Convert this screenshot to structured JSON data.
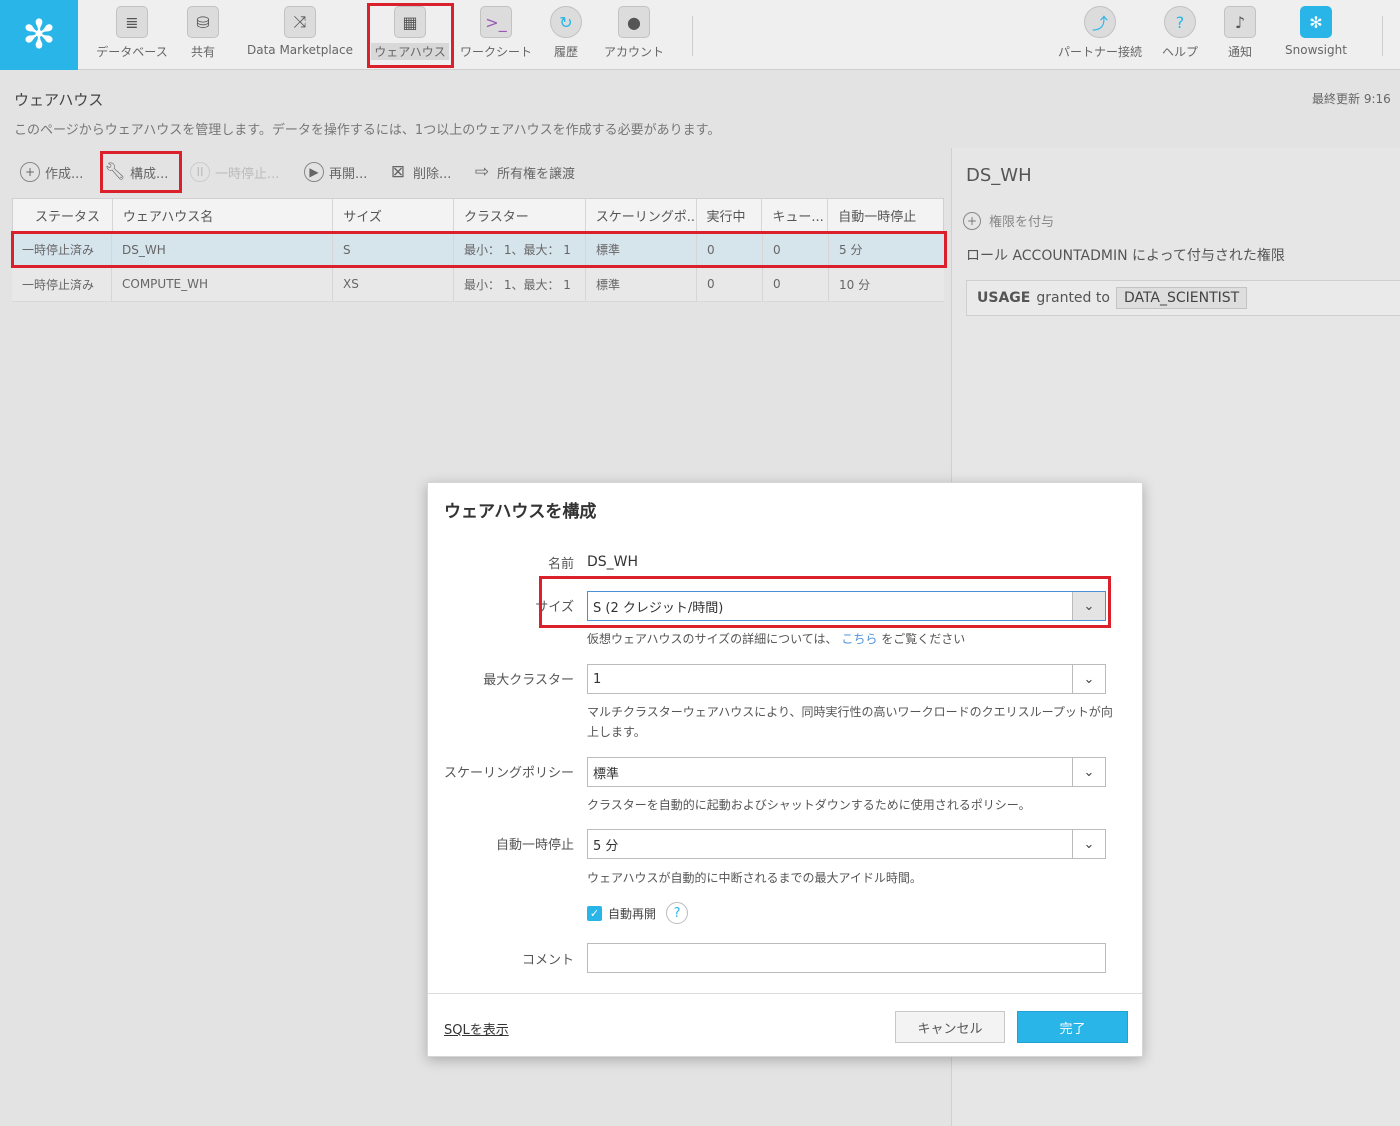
{
  "nav": {
    "items": [
      {
        "label": "データベース",
        "icon": "database-icon"
      },
      {
        "label": "共有",
        "icon": "share-icon"
      },
      {
        "label": "Data Marketplace",
        "icon": "marketplace-icon"
      },
      {
        "label": "ウェアハウス",
        "icon": "warehouse-icon"
      },
      {
        "label": "ワークシート",
        "icon": "worksheet-icon"
      },
      {
        "label": "履歴",
        "icon": "history-icon"
      },
      {
        "label": "アカウント",
        "icon": "account-icon"
      },
      {
        "label": "パートナー接続",
        "icon": "partner-connect-icon"
      },
      {
        "label": "ヘルプ",
        "icon": "help-icon"
      },
      {
        "label": "通知",
        "icon": "bell-icon"
      },
      {
        "label": "Snowsight",
        "icon": "snowsight-icon"
      }
    ]
  },
  "page": {
    "title": "ウェアハウス",
    "description": "このページからウェアハウスを管理します。データを操作するには、1つ以上のウェアハウスを作成する必要があります。",
    "last_update": "最終更新 9:16"
  },
  "toolbar": {
    "create": "作成...",
    "configure": "構成...",
    "suspend": "一時停止...",
    "resume": "再開...",
    "delete": "削除...",
    "transfer": "所有権を譲渡"
  },
  "table": {
    "headers": [
      "ステータス",
      "ウェアハウス名",
      "サイズ",
      "クラスター",
      "スケーリングポ...",
      "実行中",
      "キュー...",
      "自動一時停止"
    ],
    "rows": [
      [
        "一時停止済み",
        "DS_WH",
        "S",
        "最小： 1、最大： 1",
        "標準",
        "0",
        "0",
        "5 分"
      ],
      [
        "一時停止済み",
        "COMPUTE_WH",
        "XS",
        "最小： 1、最大： 1",
        "標準",
        "0",
        "0",
        "10 分"
      ]
    ]
  },
  "right_panel": {
    "title": "DS_WH",
    "grant_label": "権限を付与",
    "role_text": "ロール ACCOUNTADMIN によって付与された権限",
    "privilege": "USAGE",
    "granted_to": "granted to",
    "grantee": "DATA_SCIENTIST"
  },
  "dialog": {
    "title": "ウェアハウスを構成",
    "name_label": "名前",
    "name_value": "DS_WH",
    "size_label": "サイズ",
    "size_value": "S  (2 クレジット/時間)",
    "size_help_prefix": "仮想ウェアハウスのサイズの詳細については、",
    "size_help_link": "こちら",
    "size_help_suffix": "をご覧ください",
    "max_cluster_label": "最大クラスター",
    "max_cluster_value": "1",
    "max_cluster_help": "マルチクラスターウェアハウスにより、同時実行性の高いワークロードのクエリスループットが向上します。",
    "scaling_label": "スケーリングポリシー",
    "scaling_value": "標準",
    "scaling_help": "クラスターを自動的に起動およびシャットダウンするために使用されるポリシー。",
    "autosuspend_label": "自動一時停止",
    "autosuspend_value": "5 分",
    "autosuspend_help": "ウェアハウスが自動的に中断されるまでの最大アイドル時間。",
    "autoresume_label": "自動再開",
    "autoresume_checked": true,
    "comment_label": "コメント",
    "comment_value": "",
    "show_sql": "SQLを表示",
    "cancel": "キャンセル",
    "finish": "完了"
  },
  "colors": {
    "brand": "#29b5e8",
    "highlight": "#d9202b",
    "link": "#4a90d9"
  }
}
